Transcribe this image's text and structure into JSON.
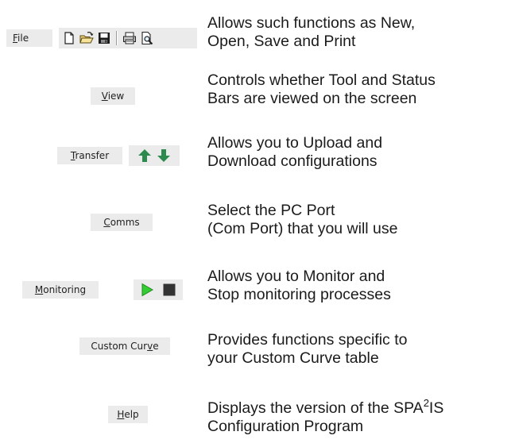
{
  "rows": [
    {
      "menu_label_prefix": "",
      "menu_label_underlined": "F",
      "menu_label_suffix": "ile",
      "toolbar_icons": [
        "new-document-icon",
        "open-folder-icon",
        "save-disk-icon",
        "print-icon",
        "print-preview-icon"
      ],
      "desc_line1": "Allows such functions as New,",
      "desc_line2": "Open, Save and Print"
    },
    {
      "menu_label_prefix": "",
      "menu_label_underlined": "V",
      "menu_label_suffix": "iew",
      "desc_line1": "Controls whether Tool and Status",
      "desc_line2": "Bars are viewed on the screen"
    },
    {
      "menu_label_prefix": "",
      "menu_label_underlined": "T",
      "menu_label_suffix": "ransfer",
      "toolbar_icons": [
        "upload-arrow-icon",
        "download-arrow-icon"
      ],
      "desc_line1": "Allows you to Upload and",
      "desc_line2": "Download configurations"
    },
    {
      "menu_label_prefix": "",
      "menu_label_underlined": "C",
      "menu_label_suffix": "omms",
      "desc_line1": "Select the PC Port",
      "desc_line2": "(Com Port) that you will use"
    },
    {
      "menu_label_prefix": "",
      "menu_label_underlined": "M",
      "menu_label_suffix": "onitoring",
      "toolbar_icons": [
        "play-icon",
        "stop-icon"
      ],
      "desc_line1": "Allows you to Monitor and",
      "desc_line2": "Stop monitoring processes"
    },
    {
      "menu_label_prefix": "Custom Cur",
      "menu_label_underlined": "v",
      "menu_label_suffix": "e",
      "desc_line1": "Provides functions specific to",
      "desc_line2": "your Custom Curve table"
    },
    {
      "menu_label_prefix": "",
      "menu_label_underlined": "H",
      "menu_label_suffix": "elp",
      "desc_line1_pre": "Displays the version of the SPA",
      "desc_line1_sup": "2",
      "desc_line1_post": "IS",
      "desc_line2": "Configuration Program"
    }
  ],
  "colors": {
    "menu_bg": "#ebebeb",
    "arrow_green": "#2d8a4e",
    "play_green": "#33cc33",
    "stop_gray": "#333333"
  }
}
